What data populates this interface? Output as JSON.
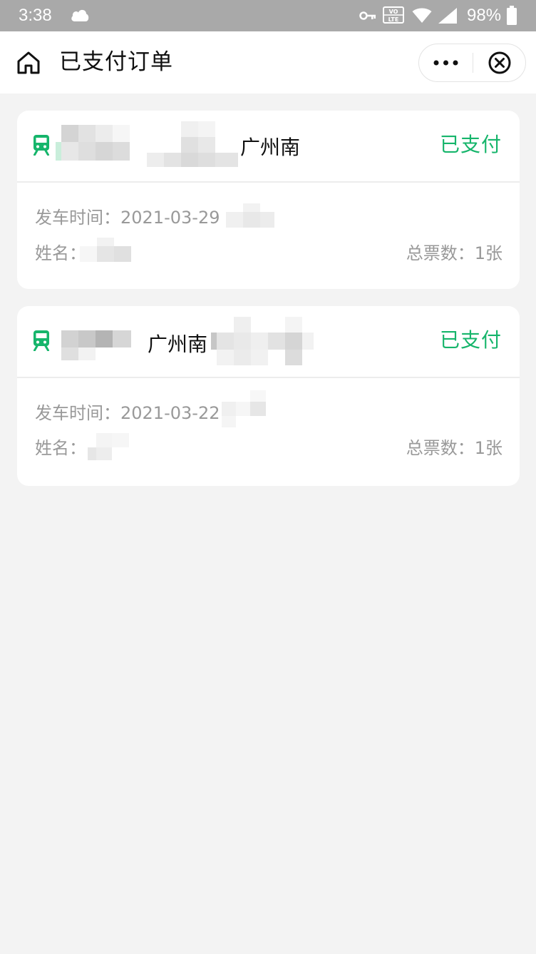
{
  "status_bar": {
    "time": "3:38",
    "battery": "98%",
    "volte_label": "VO LTE",
    "icons": [
      "cloud-icon",
      "vpn-key-icon",
      "volte-icon",
      "wifi-icon",
      "signal-icon",
      "battery-icon"
    ],
    "color": "#a9a9a9"
  },
  "nav": {
    "title": "已支付订单",
    "home_icon": "home-icon",
    "more_icon": "more-dots-icon",
    "close_icon": "close-circle-icon"
  },
  "orders": [
    {
      "station": "广州南",
      "status": "已支付",
      "depart_label": "发车时间：",
      "depart_value": "2021-03-29",
      "name_label": "姓名：",
      "count_label": "总票数：",
      "count_value": "1张"
    },
    {
      "station": "广州南",
      "status": "已支付",
      "depart_label": "发车时间：",
      "depart_value": "2021-03-22",
      "name_label": "姓名：",
      "count_label": "总票数：",
      "count_value": "1张"
    }
  ],
  "colors": {
    "accent": "#16b56b",
    "background": "#f3f3f3",
    "card": "#ffffff",
    "muted_text": "#999999"
  }
}
